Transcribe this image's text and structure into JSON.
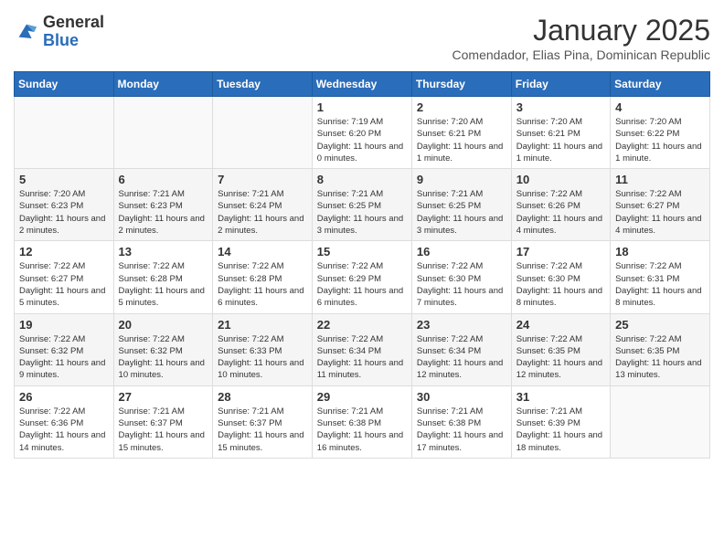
{
  "header": {
    "logo_line1": "General",
    "logo_line2": "Blue",
    "month_title": "January 2025",
    "subtitle": "Comendador, Elias Pina, Dominican Republic"
  },
  "days_of_week": [
    "Sunday",
    "Monday",
    "Tuesday",
    "Wednesday",
    "Thursday",
    "Friday",
    "Saturday"
  ],
  "weeks": [
    [
      {
        "day": "",
        "sunrise": "",
        "sunset": "",
        "daylight": ""
      },
      {
        "day": "",
        "sunrise": "",
        "sunset": "",
        "daylight": ""
      },
      {
        "day": "",
        "sunrise": "",
        "sunset": "",
        "daylight": ""
      },
      {
        "day": "1",
        "sunrise": "Sunrise: 7:19 AM",
        "sunset": "Sunset: 6:20 PM",
        "daylight": "Daylight: 11 hours and 0 minutes."
      },
      {
        "day": "2",
        "sunrise": "Sunrise: 7:20 AM",
        "sunset": "Sunset: 6:21 PM",
        "daylight": "Daylight: 11 hours and 1 minute."
      },
      {
        "day": "3",
        "sunrise": "Sunrise: 7:20 AM",
        "sunset": "Sunset: 6:21 PM",
        "daylight": "Daylight: 11 hours and 1 minute."
      },
      {
        "day": "4",
        "sunrise": "Sunrise: 7:20 AM",
        "sunset": "Sunset: 6:22 PM",
        "daylight": "Daylight: 11 hours and 1 minute."
      }
    ],
    [
      {
        "day": "5",
        "sunrise": "Sunrise: 7:20 AM",
        "sunset": "Sunset: 6:23 PM",
        "daylight": "Daylight: 11 hours and 2 minutes."
      },
      {
        "day": "6",
        "sunrise": "Sunrise: 7:21 AM",
        "sunset": "Sunset: 6:23 PM",
        "daylight": "Daylight: 11 hours and 2 minutes."
      },
      {
        "day": "7",
        "sunrise": "Sunrise: 7:21 AM",
        "sunset": "Sunset: 6:24 PM",
        "daylight": "Daylight: 11 hours and 2 minutes."
      },
      {
        "day": "8",
        "sunrise": "Sunrise: 7:21 AM",
        "sunset": "Sunset: 6:25 PM",
        "daylight": "Daylight: 11 hours and 3 minutes."
      },
      {
        "day": "9",
        "sunrise": "Sunrise: 7:21 AM",
        "sunset": "Sunset: 6:25 PM",
        "daylight": "Daylight: 11 hours and 3 minutes."
      },
      {
        "day": "10",
        "sunrise": "Sunrise: 7:22 AM",
        "sunset": "Sunset: 6:26 PM",
        "daylight": "Daylight: 11 hours and 4 minutes."
      },
      {
        "day": "11",
        "sunrise": "Sunrise: 7:22 AM",
        "sunset": "Sunset: 6:27 PM",
        "daylight": "Daylight: 11 hours and 4 minutes."
      }
    ],
    [
      {
        "day": "12",
        "sunrise": "Sunrise: 7:22 AM",
        "sunset": "Sunset: 6:27 PM",
        "daylight": "Daylight: 11 hours and 5 minutes."
      },
      {
        "day": "13",
        "sunrise": "Sunrise: 7:22 AM",
        "sunset": "Sunset: 6:28 PM",
        "daylight": "Daylight: 11 hours and 5 minutes."
      },
      {
        "day": "14",
        "sunrise": "Sunrise: 7:22 AM",
        "sunset": "Sunset: 6:28 PM",
        "daylight": "Daylight: 11 hours and 6 minutes."
      },
      {
        "day": "15",
        "sunrise": "Sunrise: 7:22 AM",
        "sunset": "Sunset: 6:29 PM",
        "daylight": "Daylight: 11 hours and 6 minutes."
      },
      {
        "day": "16",
        "sunrise": "Sunrise: 7:22 AM",
        "sunset": "Sunset: 6:30 PM",
        "daylight": "Daylight: 11 hours and 7 minutes."
      },
      {
        "day": "17",
        "sunrise": "Sunrise: 7:22 AM",
        "sunset": "Sunset: 6:30 PM",
        "daylight": "Daylight: 11 hours and 8 minutes."
      },
      {
        "day": "18",
        "sunrise": "Sunrise: 7:22 AM",
        "sunset": "Sunset: 6:31 PM",
        "daylight": "Daylight: 11 hours and 8 minutes."
      }
    ],
    [
      {
        "day": "19",
        "sunrise": "Sunrise: 7:22 AM",
        "sunset": "Sunset: 6:32 PM",
        "daylight": "Daylight: 11 hours and 9 minutes."
      },
      {
        "day": "20",
        "sunrise": "Sunrise: 7:22 AM",
        "sunset": "Sunset: 6:32 PM",
        "daylight": "Daylight: 11 hours and 10 minutes."
      },
      {
        "day": "21",
        "sunrise": "Sunrise: 7:22 AM",
        "sunset": "Sunset: 6:33 PM",
        "daylight": "Daylight: 11 hours and 10 minutes."
      },
      {
        "day": "22",
        "sunrise": "Sunrise: 7:22 AM",
        "sunset": "Sunset: 6:34 PM",
        "daylight": "Daylight: 11 hours and 11 minutes."
      },
      {
        "day": "23",
        "sunrise": "Sunrise: 7:22 AM",
        "sunset": "Sunset: 6:34 PM",
        "daylight": "Daylight: 11 hours and 12 minutes."
      },
      {
        "day": "24",
        "sunrise": "Sunrise: 7:22 AM",
        "sunset": "Sunset: 6:35 PM",
        "daylight": "Daylight: 11 hours and 12 minutes."
      },
      {
        "day": "25",
        "sunrise": "Sunrise: 7:22 AM",
        "sunset": "Sunset: 6:35 PM",
        "daylight": "Daylight: 11 hours and 13 minutes."
      }
    ],
    [
      {
        "day": "26",
        "sunrise": "Sunrise: 7:22 AM",
        "sunset": "Sunset: 6:36 PM",
        "daylight": "Daylight: 11 hours and 14 minutes."
      },
      {
        "day": "27",
        "sunrise": "Sunrise: 7:21 AM",
        "sunset": "Sunset: 6:37 PM",
        "daylight": "Daylight: 11 hours and 15 minutes."
      },
      {
        "day": "28",
        "sunrise": "Sunrise: 7:21 AM",
        "sunset": "Sunset: 6:37 PM",
        "daylight": "Daylight: 11 hours and 15 minutes."
      },
      {
        "day": "29",
        "sunrise": "Sunrise: 7:21 AM",
        "sunset": "Sunset: 6:38 PM",
        "daylight": "Daylight: 11 hours and 16 minutes."
      },
      {
        "day": "30",
        "sunrise": "Sunrise: 7:21 AM",
        "sunset": "Sunset: 6:38 PM",
        "daylight": "Daylight: 11 hours and 17 minutes."
      },
      {
        "day": "31",
        "sunrise": "Sunrise: 7:21 AM",
        "sunset": "Sunset: 6:39 PM",
        "daylight": "Daylight: 11 hours and 18 minutes."
      },
      {
        "day": "",
        "sunrise": "",
        "sunset": "",
        "daylight": ""
      }
    ]
  ]
}
